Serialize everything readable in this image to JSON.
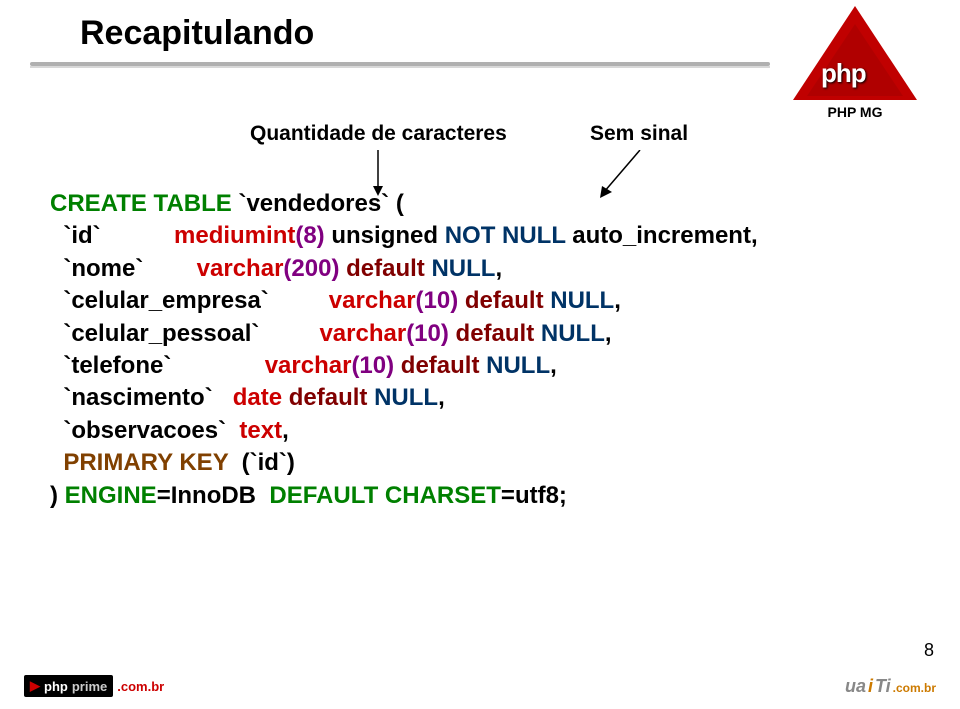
{
  "title": "Recapitulando",
  "annotation_qty": "Quantidade de caracteres",
  "annotation_sem": "Sem sinal",
  "code": {
    "create": "CREATE TABLE",
    "table": " `vendedores` (",
    "id_col": "  `id`",
    "id_type": "           mediumint",
    "id_paren": "(8)",
    "id_unsigned": " unsigned ",
    "not_null": "NOT NULL",
    "auto_inc": " auto_increment,",
    "nome_col": "  `nome`",
    "varchar": "        varchar",
    "p200": "(200)",
    "default": " default ",
    "null_kw": "NULL",
    "comma": ",",
    "cel_emp_col": "  `celular_empresa`",
    "sp1": " ",
    "p10": "(10)",
    "cel_pes_col": "  `celular_pessoal`",
    "tel_col": "  `telefone`",
    "tel_sp": "      ",
    "nasc_col": "  `nascimento`",
    "nasc_sp": "   ",
    "date_type": "date",
    "obs_col": "  `observacoes`",
    "obs_sp": "  ",
    "text_type": "text",
    "pk": "  PRIMARY KEY",
    "pk_id": "  (`id`)",
    "engine1": ") ",
    "engine_kw": "ENGINE",
    "engine_val": "=InnoDB  ",
    "charset_kw": "DEFAULT CHARSET",
    "charset_val": "=utf8;"
  },
  "logo": {
    "php": "php",
    "mg": "PHP MG"
  },
  "page_num": "8",
  "footer": {
    "phprime_php": "php",
    "phprime_prime": "prime",
    "phprime_com": ".com.br",
    "uaiti_ua": "ua",
    "uaiti_i": "i",
    "uaiti_ti": "Ti",
    "uaiti_com": ".com.br"
  }
}
